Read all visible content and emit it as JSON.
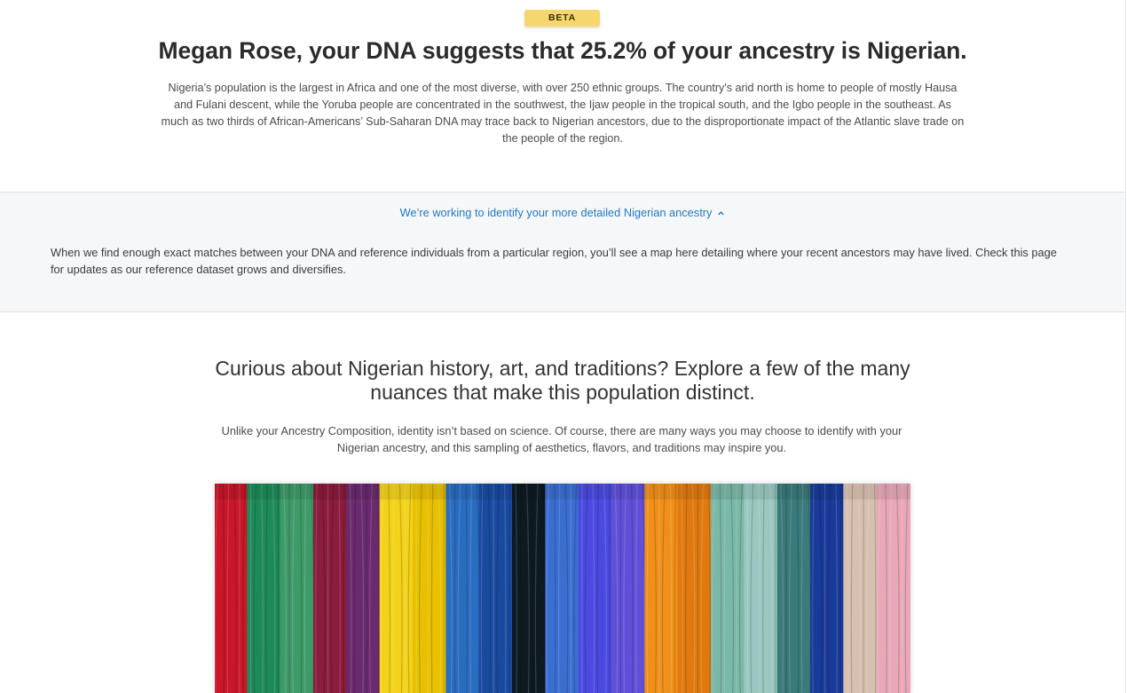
{
  "hero": {
    "badge": "BETA",
    "headline": "Megan Rose, your DNA suggests that 25.2% of your ancestry is Nigerian.",
    "description": "Nigeria’s population is the largest in Africa and one of the most diverse, with over 250 ethnic groups. The country's arid north is home to people of mostly Hausa and Fulani descent, while the Yoruba people are concentrated in the southwest, the Ijaw people in the tropical south, and the Igbo people in the southeast. As much as two thirds of African-Americans’ Sub-Saharan DNA may trace back to Nigerian ancestors, due to the disproportionate impact of the Atlantic slave trade on the people of the region."
  },
  "detail_panel": {
    "toggle_label": "We’re working to identify your more detailed Nigerian ancestry",
    "toggle_icon": "chevron-up-icon",
    "body": "When we find enough exact matches between your DNA and reference individuals from a particular region, you’ll see a map here detailing where your recent ancestors may have lived. Check this page for updates as our reference dataset grows and diversifies."
  },
  "explore": {
    "heading": "Curious about Nigerian history, art, and traditions? Explore a few of the many nuances that make this population distinct.",
    "subtext": "Unlike your Ancestry Composition, identity isn’t based on science. Of course, there are many ways you may choose to identify with your Nigerian ancestry, and this sampling of aesthetics, flavors, and traditions may inspire you.",
    "image_subject": "hanging-colorful-yarn-skeins",
    "yarn_colors": [
      "#c8162a",
      "#1e8a5a",
      "#3f9a6a",
      "#8a1c3c",
      "#6a2a6e",
      "#f2d21a",
      "#e8c000",
      "#2a6cc0",
      "#1a4aa0",
      "#0e1a22",
      "#3a6ed0",
      "#4a4ae0",
      "#6050d8",
      "#f0901a",
      "#e07a10",
      "#7ab8a8",
      "#9ac8c0",
      "#3a7a7a",
      "#1a3a9a",
      "#d8c0b0",
      "#e8a8b8"
    ]
  }
}
